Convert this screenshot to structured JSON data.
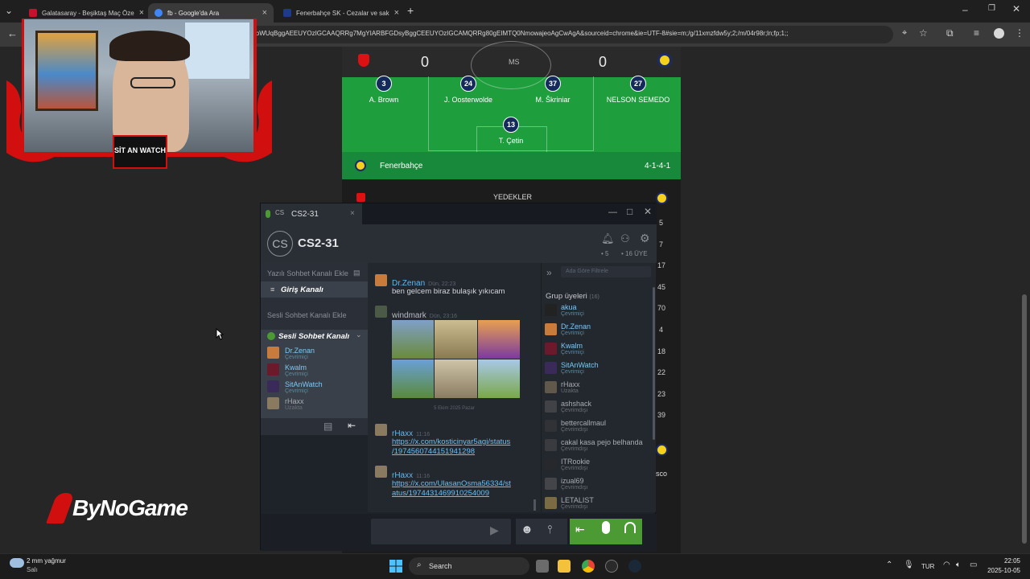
{
  "browser": {
    "tabs": [
      {
        "label": "Galatasaray - Beşiktaş Maç Öze",
        "color": "#c8102e"
      },
      {
        "label": "fb - Google'da Ara",
        "color": "#4285f4"
      },
      {
        "label": "Fenerbahçe SK - Cezalar ve sak",
        "color": "#1e3a8a"
      }
    ],
    "new_tab_symbol": "+",
    "url": "jvbWUqBggAEEUYOzIGCAAQRRg7MgYIARBFGDsyBggCEEUYOzIGCAMQRRg80gEIMTQ0NmowajeoAgCwAgA&sourceid=chrome&ie=UTF-8#sie=m;/g/11xmzfdw5y;2;/m/04r98r;ln;fp;1;;"
  },
  "match": {
    "home_score": "0",
    "away_score": "0",
    "status": "MS",
    "players": [
      {
        "number": "3",
        "name": "A. Brown"
      },
      {
        "number": "24",
        "name": "J. Oosterwolde"
      },
      {
        "number": "37",
        "name": "M. Škriniar"
      },
      {
        "number": "27",
        "name": "NELSON SEMEDO"
      },
      {
        "number": "13",
        "name": "T. Çetin"
      }
    ],
    "team_name": "Fenerbahçe",
    "formation": "4-1-4-1",
    "subs_title": "YEDEKLER",
    "sub_numbers": [
      "5",
      "7",
      "17",
      "45",
      "70",
      "4",
      "18",
      "22",
      "23",
      "39"
    ],
    "partial_name": "sco",
    "colors": {
      "pitch": "#1f9e3e",
      "team_bar": "#18893a"
    }
  },
  "stream": {
    "brand": "ByNoGame",
    "webcam_badge": "SİT AN WATCH"
  },
  "steam": {
    "title_tab": "CS2-31",
    "group_name": "CS2-31",
    "group_logo": "CS",
    "online_count": "• 5",
    "member_count": "• 16 ÜYE",
    "add_text_channel": "Yazılı Sohbet Kanalı Ekle",
    "entry_channel": "Giriş Kanalı",
    "add_voice_channel": "Sesli Sohbet Kanalı Ekle",
    "voice_channel": "Sesli Sohbet Kanalı",
    "voice_members": [
      {
        "name": "Dr.Zenan",
        "status": "Çevrimiçi"
      },
      {
        "name": "Kwalm",
        "status": "Çevrimiçi"
      },
      {
        "name": "SitAnWatch",
        "status": "Çevrimiçi"
      },
      {
        "name": "rHaxx",
        "status": "Uzakta"
      }
    ],
    "messages": [
      {
        "author": "Dr.Zenan",
        "time": "Dün, 22:23",
        "text": "ben gelcem biraz bulaşık yıkıcam"
      },
      {
        "author": "windmark",
        "time": "Dün, 23:16"
      }
    ],
    "date_divider": "5 Ekim 2025 Pazar",
    "link_messages": [
      {
        "author": "rHaxx",
        "time": "11:16",
        "lines": [
          "https://x.com/kosticinyar5agi/status",
          "/1974560744151941298"
        ]
      },
      {
        "author": "rHaxx",
        "time": "11:16",
        "lines": [
          "https://x.com/UlasanOsma56334/st",
          "atus/1974431469910254009"
        ]
      }
    ],
    "filter_placeholder": "Ada Göre Filtrele",
    "members_title": "Grup üyeleri",
    "members_count": "(16)",
    "members": [
      {
        "name": "akua",
        "status": "Çevrimiçi",
        "online": true
      },
      {
        "name": "Dr.Zenan",
        "status": "Çevrimiçi",
        "online": true
      },
      {
        "name": "Kwalm",
        "status": "Çevrimiçi",
        "online": true
      },
      {
        "name": "SitAnWatch",
        "status": "Çevrimiçi",
        "online": true
      },
      {
        "name": "rHaxx",
        "status": "Uzakta",
        "online": false
      },
      {
        "name": "ashshack",
        "status": "Çevrimdışı",
        "online": false
      },
      {
        "name": "bettercallmaul",
        "status": "Çevrimdışı",
        "online": false
      },
      {
        "name": "cakal kasa pejo belhanda",
        "status": "Çevrimdışı",
        "online": false
      },
      {
        "name": "ITRookie",
        "status": "Çevrimdışı",
        "online": false
      },
      {
        "name": "izual69",
        "status": "Çevrimdışı",
        "online": false
      },
      {
        "name": "LETALIST",
        "status": "Çevrimdışı",
        "online": false
      }
    ],
    "colors": {
      "accent": "#67c1f5",
      "voice_green": "#4b9a33"
    }
  },
  "taskbar": {
    "weather_temp": "2 mm yağmur",
    "weather_day": "Salı",
    "search_label": "Search",
    "lang": "TUR",
    "time": "22:05",
    "date": "2025-10-05"
  }
}
